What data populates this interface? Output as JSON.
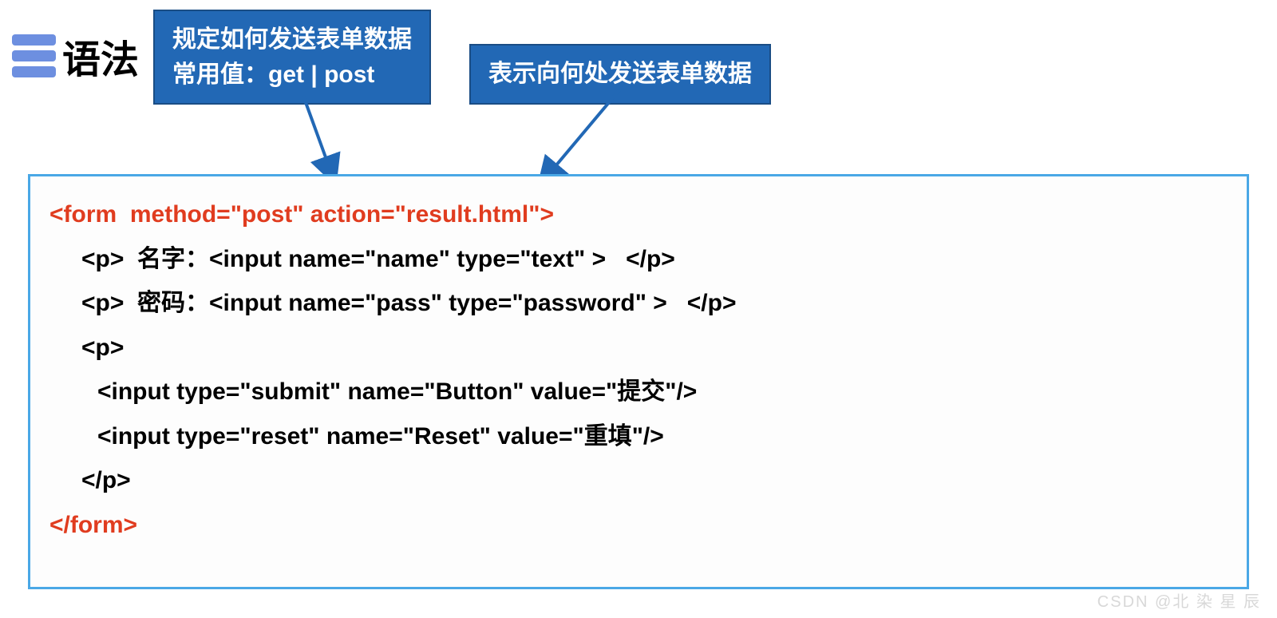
{
  "header": {
    "title": "语法"
  },
  "callouts": {
    "method": {
      "line1": "规定如何发送表单数据",
      "line2": "常用值：get  | post"
    },
    "action": {
      "text": "表示向何处发送表单数据"
    }
  },
  "code": {
    "line1": "<form  method=\"post\" action=\"result.html\">",
    "line2": "<p>  名字：<input name=\"name\" type=\"text\" >   </p>",
    "line3": "<p>  密码：<input name=\"pass\" type=\"password\" >   </p>",
    "line4": "<p>",
    "line5": "<input type=\"submit\" name=\"Button\" value=\"提交\"/>",
    "line6": "<input type=\"reset\" name=\"Reset\" value=\"重填\"/>",
    "line7": "</p>",
    "line8": "</form>"
  },
  "watermark": "CSDN @北 染 星 辰"
}
